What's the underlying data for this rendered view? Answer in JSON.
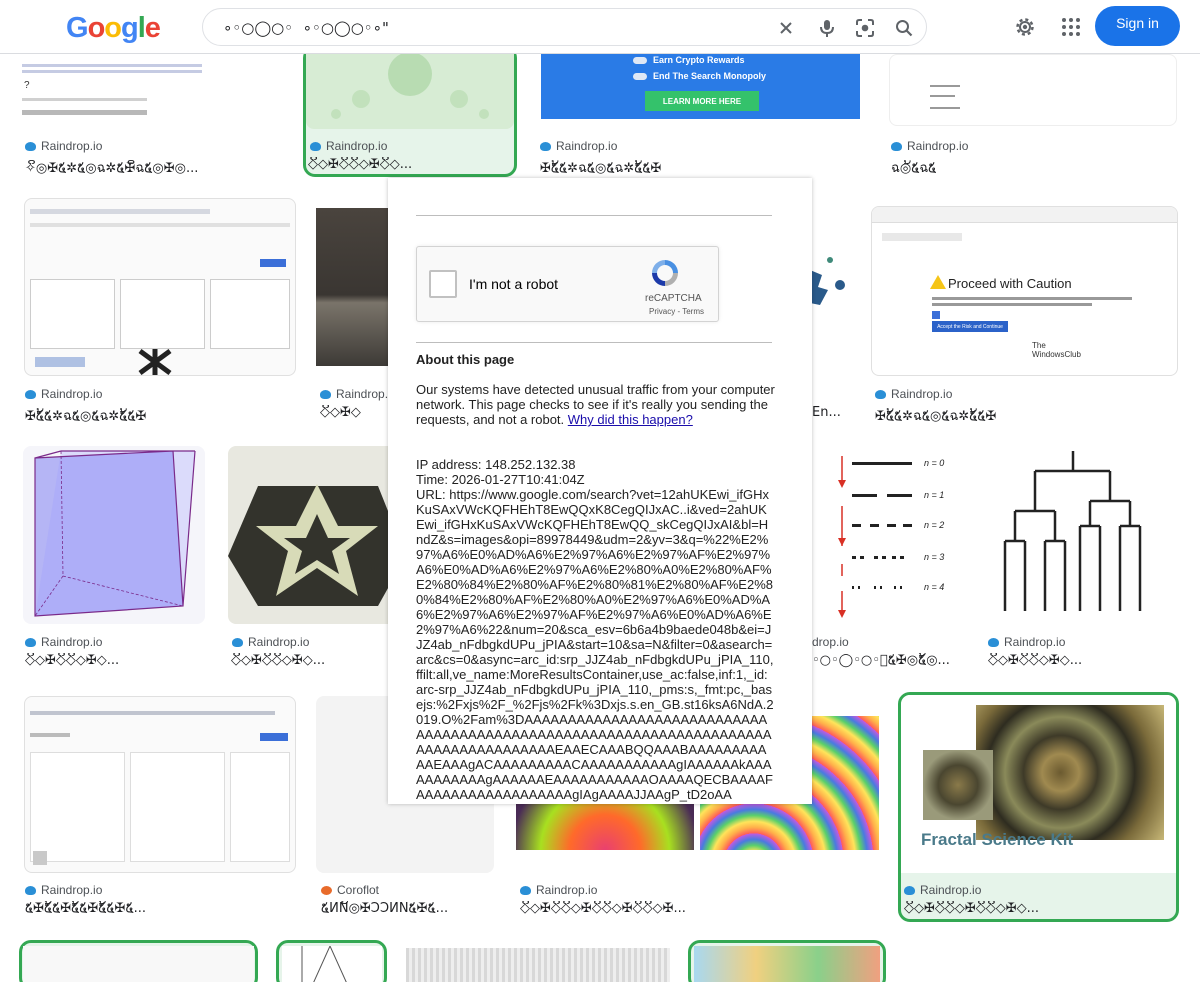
{
  "header": {
    "logo_letters": [
      "G",
      "o",
      "o",
      "g",
      "l",
      "e"
    ],
    "search_value": "∘◦○◯○◦  ∘◦○◯○◦∘\"",
    "signin_label": "Sign in",
    "icons": [
      "clear-icon",
      "mic-icon",
      "lens-icon",
      "search-icon",
      "settings-icon",
      "apps-icon"
    ]
  },
  "tiles": [
    {
      "source": "Raindrop.io",
      "title": "✧ິ◎✠໕✲໕◎ฉ✲໕✠ິฉ໕◎✠◎..."
    },
    {
      "source": "Raindrop.io",
      "title": "◇ິ◇✠◇ິ◇ິ◇✠◇ິ◇..."
    },
    {
      "source": "Raindrop.io",
      "title": "✠໕້໕✲ฉ໕◎໕ฉ✲໕້໕✠"
    },
    {
      "source": "Raindrop.io",
      "title": "ฉ◎້໕ฉ໕"
    },
    {
      "source": "Raindrop.io",
      "title": "✠໕້໕✲ฉ໕◎໕ฉ✲໕້໕✠"
    },
    {
      "source": "Raindrop.io",
      "title": "◇ິ◇✠◇"
    },
    {
      "source": "",
      "title": "En..."
    },
    {
      "source": "Raindrop.io",
      "title": "✠໕້໕✲ฉ໕◎໕ฉ✲໕້໕✠"
    },
    {
      "source": "Raindrop.io",
      "title": "◇ິ◇✠◇ິ◇ິ◇✠◇..."
    },
    {
      "source": "Raindrop.io",
      "title": "◇ິ◇✠◇ິ◇ິ◇✠◇..."
    },
    {
      "source": "drop.io",
      "title": "◦○◦◯◦○◦้໕✠◎໕້◎..."
    },
    {
      "source": "Raindrop.io",
      "title": "◇ິ◇✠◇ິ◇ິ◇✠◇..."
    },
    {
      "source": "Raindrop.io",
      "title": "໕✠໕້໕✠໕້໕✠໕້໕✠໕..."
    },
    {
      "source": "Coroflot",
      "title": "໕ИN້◎✠ƆƆИN໕✠໕..."
    },
    {
      "source": "Raindrop.io",
      "title": "◇ິ◇✠◇ິ◇ິ◇✠◇ິ◇ິ◇✠◇ິ◇ິ◇✠..."
    },
    {
      "source": "Raindrop.io",
      "title": "◇ິ◇✠◇ິ◇ິ◇✠◇ິ◇ິ◇✠◇..."
    }
  ],
  "thumb_text": {
    "earn": "Earn Crypto Rewards",
    "end": "End The Search Monopoly",
    "learn": "LEARN MORE HERE",
    "proceed": "Proceed with Caution",
    "accept": "Accept the Risk and Continue",
    "windowsclub": "The WindowsClub",
    "fractal": "Fractal Science Kit",
    "n_labels": [
      "n = 0",
      "n = 1",
      "n = 2",
      "n = 3",
      "n = 4"
    ]
  },
  "overlay": {
    "robot_label": "I'm not a robot",
    "recaptcha_brand": "reCAPTCHA",
    "privacy": "Privacy",
    "terms": "Terms",
    "about_heading": "About this page",
    "about_body": "Our systems have detected unusual traffic from your computer network. This page checks to see if it's really you sending the requests, and not a robot.",
    "why_link": "Why did this happen?",
    "ip_line": "IP address: 148.252.132.38",
    "time_line": "Time: 2026-01-27T10:41:04Z",
    "url_line": "URL: https://www.google.com/search?vet=12ahUKEwi_ifGHxKuSAxVWcKQFHEhT8EwQQxK8CegQIJxAC..i&ved=2ahUKEwi_ifGHxKuSAxVWcKQFHEhT8EwQQ_skCegQIJxAI&bl=HndZ&s=images&opi=89978449&udm=2&yv=3&q=%22%E2%97%A6%E0%AD%A6%E2%97%A6%E2%97%AF%E2%97%A6%E0%AD%A6%E2%97%A6%E2%80%A0%E2%80%AF%E2%80%84%E2%80%AF%E2%80%81%E2%80%AF%E2%80%84%E2%80%AF%E2%80%A0%E2%97%A6%E0%AD%A6%E2%97%A6%E2%97%AF%E2%97%A6%E0%AD%A6%E2%97%A6%22&num=20&sca_esv=6b6a4b9baede048b&ei=JJZ4ab_nFdbgkdUPu_jPIA&start=10&sa=N&filter=0&asearch=arc&cs=0&async=arc_id:srp_JJZ4ab_nFdbgkdUPu_jPIA_110,ffilt:all,ve_name:MoreResultsContainer,use_ac:false,inf:1,_id:arc-srp_JJZ4ab_nFdbgkdUPu_jPIA_110,_pms:s,_fmt:pc,_basejs:%2Fxjs%2F_%2Fjs%2Fk%3Dxjs.s.en_GB.st16ksA6NdA.2019.O%2Fam%3DAAAAAAAAAAAAAAAAAAAAAAAAAAAAAAAAAAAAAAAAAAAAAAAAAAAAAAAAAAAAAAAAAAAAAAAAAAAAAAAAAAAAAEAAECAAABQQAAABAAAAAAAAAAAEAAAgACAAAAAAAAACAAAAAAAAAAAgIAAAAAAkAAAAAAAAAAAgAAAAAAEAAAAAAAAAAAOAAAAQECBAAAAFAAAAAAAAAAAAAAAAAAgIAgAAAAJJAAgP_tD2oAA"
  }
}
